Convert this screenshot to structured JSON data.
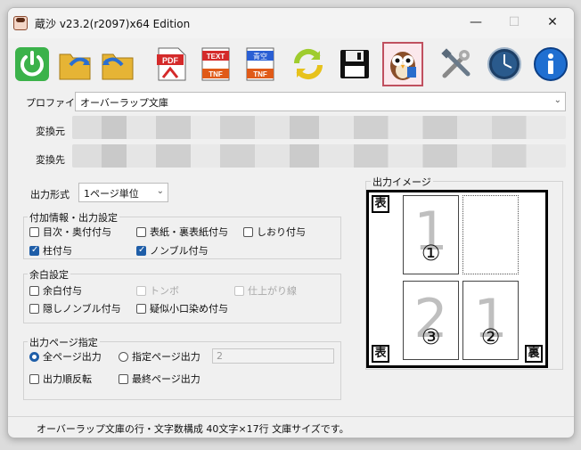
{
  "window": {
    "title": "蔵沙 v23.2(r2097)x64 Edition",
    "minimize": "—",
    "maximize": "☐",
    "close": "✕"
  },
  "profile": {
    "label": "プロファイル",
    "value": "オーバーラップ文庫"
  },
  "source": {
    "label": "変換元"
  },
  "destination": {
    "label": "変換先"
  },
  "output_format": {
    "label": "出力形式",
    "value": "1ページ単位"
  },
  "info_settings": {
    "title": "付加情報・出力設定",
    "items": [
      {
        "label": "目次・奥付付与",
        "checked": false
      },
      {
        "label": "表紙・裏表紙付与",
        "checked": false
      },
      {
        "label": "しおり付与",
        "checked": false
      },
      {
        "label": "柱付与",
        "checked": true
      },
      {
        "label": "ノンブル付与",
        "checked": true
      }
    ]
  },
  "margin_settings": {
    "title": "余白設定",
    "items": [
      {
        "label": "余白付与",
        "checked": false
      },
      {
        "label": "トンボ",
        "checked": false,
        "disabled": true
      },
      {
        "label": "仕上がり線",
        "checked": false,
        "disabled": true
      },
      {
        "label": "隠しノンブル付与",
        "checked": false
      },
      {
        "label": "疑似小口染め付与",
        "checked": false
      }
    ]
  },
  "page_spec": {
    "title": "出力ページ指定",
    "all_pages": "全ページ出力",
    "specified_pages": "指定ページ出力",
    "specified_value": "2",
    "reverse": "出力順反転",
    "last_page": "最終ページ出力"
  },
  "preview": {
    "title": "出力イメージ",
    "front": "表",
    "back": "裏",
    "pages": [
      {
        "num": "1",
        "circ": "①"
      },
      {
        "num": "2",
        "circ": "③"
      },
      {
        "num": "1",
        "circ": "②"
      }
    ]
  },
  "status": "オーバーラップ文庫の行・文字数構成 40文字×17行 文庫サイズです。",
  "toolbar": {
    "icons": [
      "power-icon",
      "folder-forward-icon",
      "folder-back-icon",
      "pdf-icon",
      "text-tnf-icon",
      "aozora-tnf-icon",
      "refresh-icon",
      "save-disk-icon",
      "owl-icon",
      "tools-icon",
      "clock-icon",
      "info-icon"
    ],
    "pdf_text": "PDF",
    "text_text": "TEXT",
    "tnf_text": "TNF",
    "aozora_text": "青空"
  }
}
